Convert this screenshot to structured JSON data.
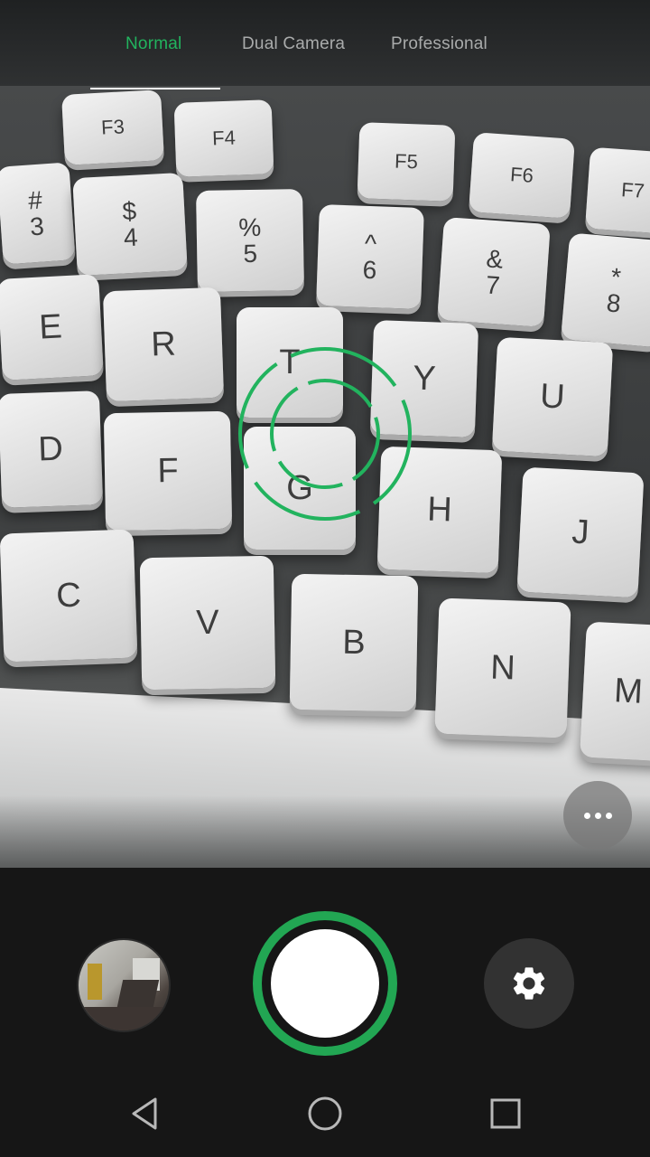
{
  "mode_tabs": [
    {
      "label": "Normal",
      "active": true
    },
    {
      "label": "Dual Camera",
      "active": false
    },
    {
      "label": "Professional",
      "active": false
    }
  ],
  "colors": {
    "accent": "#22b35e",
    "shutter_ring": "#22a653",
    "inactive_tab": "#a9abab",
    "control_bg": "#161616",
    "settings_bg": "#323232"
  },
  "viewfinder_keys": [
    {
      "label": "F3",
      "sub": ""
    },
    {
      "label": "F4",
      "sub": ""
    },
    {
      "label": "F5",
      "sub": ""
    },
    {
      "label": "F6",
      "sub": ""
    },
    {
      "label": "F7",
      "sub": ""
    },
    {
      "label": "#",
      "sub": "3"
    },
    {
      "label": "$",
      "sub": "4"
    },
    {
      "label": "%",
      "sub": "5"
    },
    {
      "label": "^",
      "sub": "6"
    },
    {
      "label": "&",
      "sub": "7"
    },
    {
      "label": "*",
      "sub": "8"
    },
    {
      "label": "E",
      "sub": ""
    },
    {
      "label": "R",
      "sub": ""
    },
    {
      "label": "T",
      "sub": ""
    },
    {
      "label": "Y",
      "sub": ""
    },
    {
      "label": "U",
      "sub": ""
    },
    {
      "label": "D",
      "sub": ""
    },
    {
      "label": "F",
      "sub": ""
    },
    {
      "label": "G",
      "sub": ""
    },
    {
      "label": "H",
      "sub": ""
    },
    {
      "label": "J",
      "sub": ""
    },
    {
      "label": "C",
      "sub": ""
    },
    {
      "label": "V",
      "sub": ""
    },
    {
      "label": "B",
      "sub": ""
    },
    {
      "label": "N",
      "sub": ""
    },
    {
      "label": "M",
      "sub": ""
    }
  ],
  "icons": {
    "more": "more-horizontal-icon",
    "settings": "gear-icon",
    "back": "back-triangle-icon",
    "home": "home-circle-icon",
    "recents": "recents-square-icon",
    "focus": "focus-reticle-icon"
  }
}
